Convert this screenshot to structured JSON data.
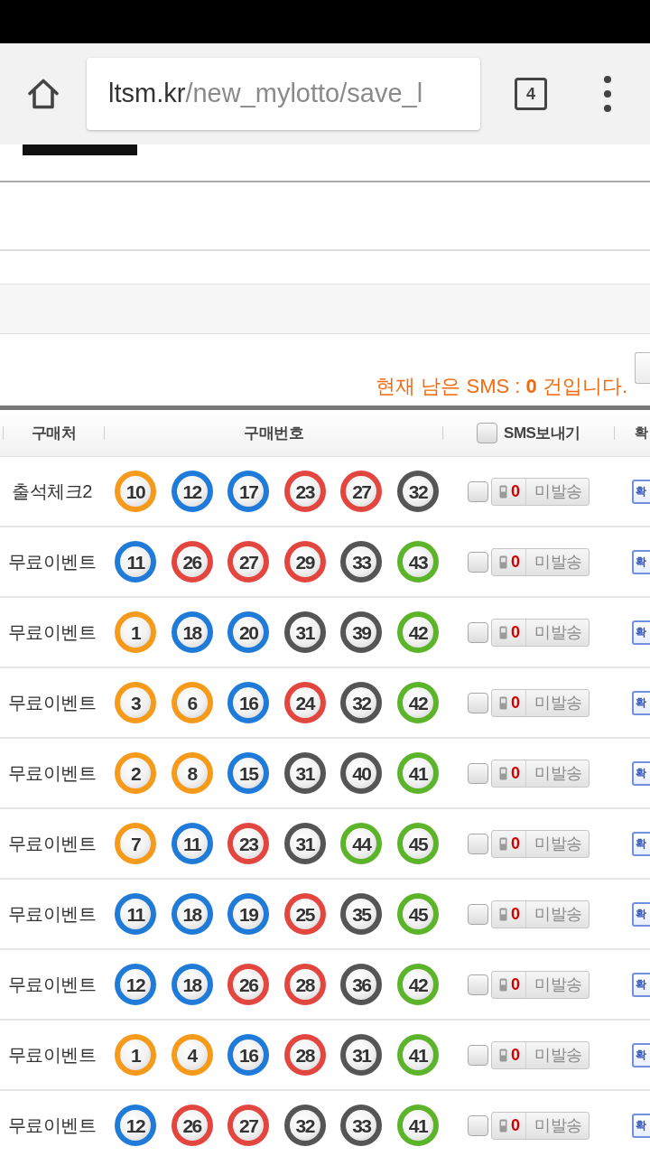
{
  "browser": {
    "url_host": "ltsm.kr",
    "url_path": "/new_mylotto/save_l",
    "tab_count": "4"
  },
  "sms_notice": {
    "text": "현재 남은 SMS : **0** 건입니다."
  },
  "table": {
    "columns": [
      {
        "kind": "text",
        "label": "구매처"
      },
      {
        "kind": "text",
        "label": "구매번호"
      },
      {
        "kind": "checkbox",
        "label": "SMS보내기",
        "checked": false
      },
      {
        "kind": "text",
        "label": "확"
      }
    ],
    "rows": [
      {
        "store": "출석체크2",
        "numbers": [
          {
            "number": "10",
            "color": "#f59a1b"
          },
          {
            "number": "12",
            "color": "#1f7ad8"
          },
          {
            "number": "17",
            "color": "#1f7ad8"
          },
          {
            "number": "23",
            "color": "#e2463f"
          },
          {
            "number": "27",
            "color": "#e2463f"
          },
          {
            "number": "32",
            "color": "#555555"
          }
        ],
        "checked": false,
        "sms_count": "0",
        "sms_status": "미발송",
        "action": "확"
      },
      {
        "store": "무료이벤트",
        "numbers": [
          {
            "number": "11",
            "color": "#1f7ad8"
          },
          {
            "number": "26",
            "color": "#e2463f"
          },
          {
            "number": "27",
            "color": "#e2463f"
          },
          {
            "number": "29",
            "color": "#e2463f"
          },
          {
            "number": "33",
            "color": "#555555"
          },
          {
            "number": "43",
            "color": "#5bb42a"
          }
        ],
        "checked": false,
        "sms_count": "0",
        "sms_status": "미발송",
        "action": "확"
      },
      {
        "store": "무료이벤트",
        "numbers": [
          {
            "number": "1",
            "color": "#f59a1b"
          },
          {
            "number": "18",
            "color": "#1f7ad8"
          },
          {
            "number": "20",
            "color": "#1f7ad8"
          },
          {
            "number": "31",
            "color": "#555555"
          },
          {
            "number": "39",
            "color": "#555555"
          },
          {
            "number": "42",
            "color": "#5bb42a"
          }
        ],
        "checked": false,
        "sms_count": "0",
        "sms_status": "미발송",
        "action": "확"
      },
      {
        "store": "무료이벤트",
        "numbers": [
          {
            "number": "3",
            "color": "#f59a1b"
          },
          {
            "number": "6",
            "color": "#f59a1b"
          },
          {
            "number": "16",
            "color": "#1f7ad8"
          },
          {
            "number": "24",
            "color": "#e2463f"
          },
          {
            "number": "32",
            "color": "#555555"
          },
          {
            "number": "42",
            "color": "#5bb42a"
          }
        ],
        "checked": false,
        "sms_count": "0",
        "sms_status": "미발송",
        "action": "확"
      },
      {
        "store": "무료이벤트",
        "numbers": [
          {
            "number": "2",
            "color": "#f59a1b"
          },
          {
            "number": "8",
            "color": "#f59a1b"
          },
          {
            "number": "15",
            "color": "#1f7ad8"
          },
          {
            "number": "31",
            "color": "#555555"
          },
          {
            "number": "40",
            "color": "#555555"
          },
          {
            "number": "41",
            "color": "#5bb42a"
          }
        ],
        "checked": false,
        "sms_count": "0",
        "sms_status": "미발송",
        "action": "확"
      },
      {
        "store": "무료이벤트",
        "numbers": [
          {
            "number": "7",
            "color": "#f59a1b"
          },
          {
            "number": "11",
            "color": "#1f7ad8"
          },
          {
            "number": "23",
            "color": "#e2463f"
          },
          {
            "number": "31",
            "color": "#555555"
          },
          {
            "number": "44",
            "color": "#5bb42a"
          },
          {
            "number": "45",
            "color": "#5bb42a"
          }
        ],
        "checked": false,
        "sms_count": "0",
        "sms_status": "미발송",
        "action": "확"
      },
      {
        "store": "무료이벤트",
        "numbers": [
          {
            "number": "11",
            "color": "#1f7ad8"
          },
          {
            "number": "18",
            "color": "#1f7ad8"
          },
          {
            "number": "19",
            "color": "#1f7ad8"
          },
          {
            "number": "25",
            "color": "#e2463f"
          },
          {
            "number": "35",
            "color": "#555555"
          },
          {
            "number": "45",
            "color": "#5bb42a"
          }
        ],
        "checked": false,
        "sms_count": "0",
        "sms_status": "미발송",
        "action": "확"
      },
      {
        "store": "무료이벤트",
        "numbers": [
          {
            "number": "12",
            "color": "#1f7ad8"
          },
          {
            "number": "18",
            "color": "#1f7ad8"
          },
          {
            "number": "26",
            "color": "#e2463f"
          },
          {
            "number": "28",
            "color": "#e2463f"
          },
          {
            "number": "36",
            "color": "#555555"
          },
          {
            "number": "42",
            "color": "#5bb42a"
          }
        ],
        "checked": false,
        "sms_count": "0",
        "sms_status": "미발송",
        "action": "확"
      },
      {
        "store": "무료이벤트",
        "numbers": [
          {
            "number": "1",
            "color": "#f59a1b"
          },
          {
            "number": "4",
            "color": "#f59a1b"
          },
          {
            "number": "16",
            "color": "#1f7ad8"
          },
          {
            "number": "28",
            "color": "#e2463f"
          },
          {
            "number": "31",
            "color": "#555555"
          },
          {
            "number": "41",
            "color": "#5bb42a"
          }
        ],
        "checked": false,
        "sms_count": "0",
        "sms_status": "미발송",
        "action": "확"
      },
      {
        "store": "무료이벤트",
        "numbers": [
          {
            "number": "12",
            "color": "#1f7ad8"
          },
          {
            "number": "26",
            "color": "#e2463f"
          },
          {
            "number": "27",
            "color": "#e2463f"
          },
          {
            "number": "32",
            "color": "#555555"
          },
          {
            "number": "33",
            "color": "#555555"
          },
          {
            "number": "41",
            "color": "#5bb42a"
          }
        ],
        "checked": false,
        "sms_count": "0",
        "sms_status": "미발송",
        "action": "확"
      }
    ]
  }
}
